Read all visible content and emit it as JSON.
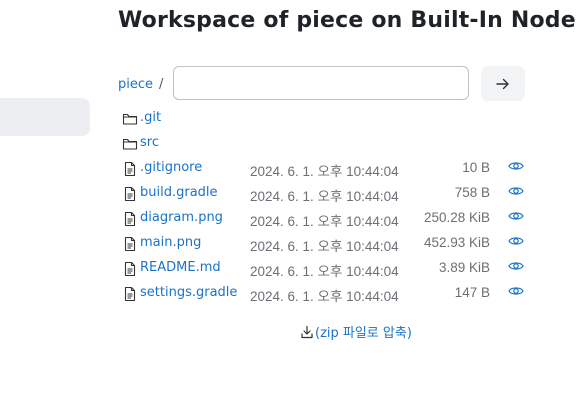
{
  "title": "Workspace of piece on Built-In Node",
  "breadcrumb": {
    "root": "piece",
    "separator": "/"
  },
  "path_input": {
    "value": "",
    "placeholder": ""
  },
  "go_button": {
    "icon": "arrow-right-icon"
  },
  "directories": [
    {
      "name": ".git",
      "icon": "folder-icon"
    },
    {
      "name": "src",
      "icon": "folder-icon"
    }
  ],
  "files": [
    {
      "name": ".gitignore",
      "date": "2024. 6. 1. 오후 10:44:04",
      "size": "10 B"
    },
    {
      "name": "build.gradle",
      "date": "2024. 6. 1. 오후 10:44:04",
      "size": "758 B"
    },
    {
      "name": "diagram.png",
      "date": "2024. 6. 1. 오후 10:44:04",
      "size": "250.28 KiB"
    },
    {
      "name": "main.png",
      "date": "2024. 6. 1. 오후 10:44:04",
      "size": "452.93 KiB"
    },
    {
      "name": "README.md",
      "date": "2024. 6. 1. 오후 10:44:04",
      "size": "3.89 KiB"
    },
    {
      "name": "settings.gradle",
      "date": "2024. 6. 1. 오후 10:44:04",
      "size": "147 B"
    }
  ],
  "zip_link": "(zip 파일로 압축)",
  "colors": {
    "link": "#1a73c8",
    "muted": "#6b7075",
    "sidebar_active": "#eceef2"
  }
}
